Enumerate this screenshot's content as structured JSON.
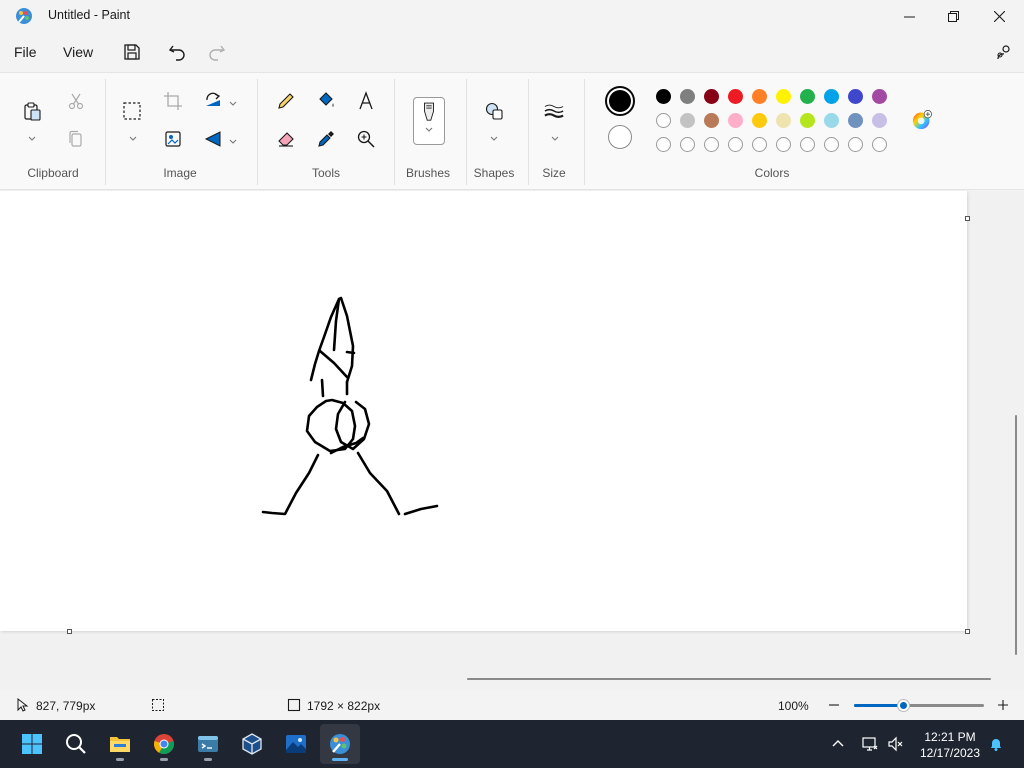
{
  "window": {
    "title": "Untitled - Paint",
    "controls": [
      "minimize",
      "maximize",
      "close"
    ]
  },
  "menu": {
    "file_label": "File",
    "view_label": "View",
    "quick_actions": [
      "save-icon",
      "undo-icon",
      "redo-icon"
    ],
    "settings_icon": "settings-icon"
  },
  "ribbon": {
    "groups": {
      "clipboard": "Clipboard",
      "image": "Image",
      "tools": "Tools",
      "brushes": "Brushes",
      "shapes": "Shapes",
      "size": "Size",
      "colors": "Colors"
    }
  },
  "colors": {
    "primary": "#000000",
    "secondary": "#ffffff",
    "row1": [
      "#000000",
      "#7f7f7f",
      "#880015",
      "#ed1c24",
      "#ff7f27",
      "#fff200",
      "#22b14c",
      "#00a2e8",
      "#3f48cc",
      "#a349a4"
    ],
    "row2": [
      "#ffffff",
      "#c3c3c3",
      "#b97a57",
      "#ffaec9",
      "#ffc90e",
      "#efe4b0",
      "#b5e61d",
      "#99d9ea",
      "#7092be",
      "#c8bfe7"
    ],
    "row3": [
      "#ffffff",
      "#ffffff",
      "#ffffff",
      "#ffffff",
      "#ffffff",
      "#ffffff",
      "#ffffff",
      "#ffffff",
      "#ffffff",
      "#ffffff"
    ],
    "accent": "#0067c0"
  },
  "status": {
    "cursor_position": "827, 779px",
    "canvas_size": "1792 × 822px",
    "zoom_level": "100%",
    "zoom_fraction": 0.38
  },
  "taskbar": {
    "apps": [
      "start-icon",
      "search-icon",
      "file-explorer-icon",
      "chrome-icon",
      "terminal-icon",
      "virtualbox-icon",
      "photos-icon",
      "paint-icon"
    ],
    "time": "12:21 PM",
    "date": "12/17/2023"
  }
}
